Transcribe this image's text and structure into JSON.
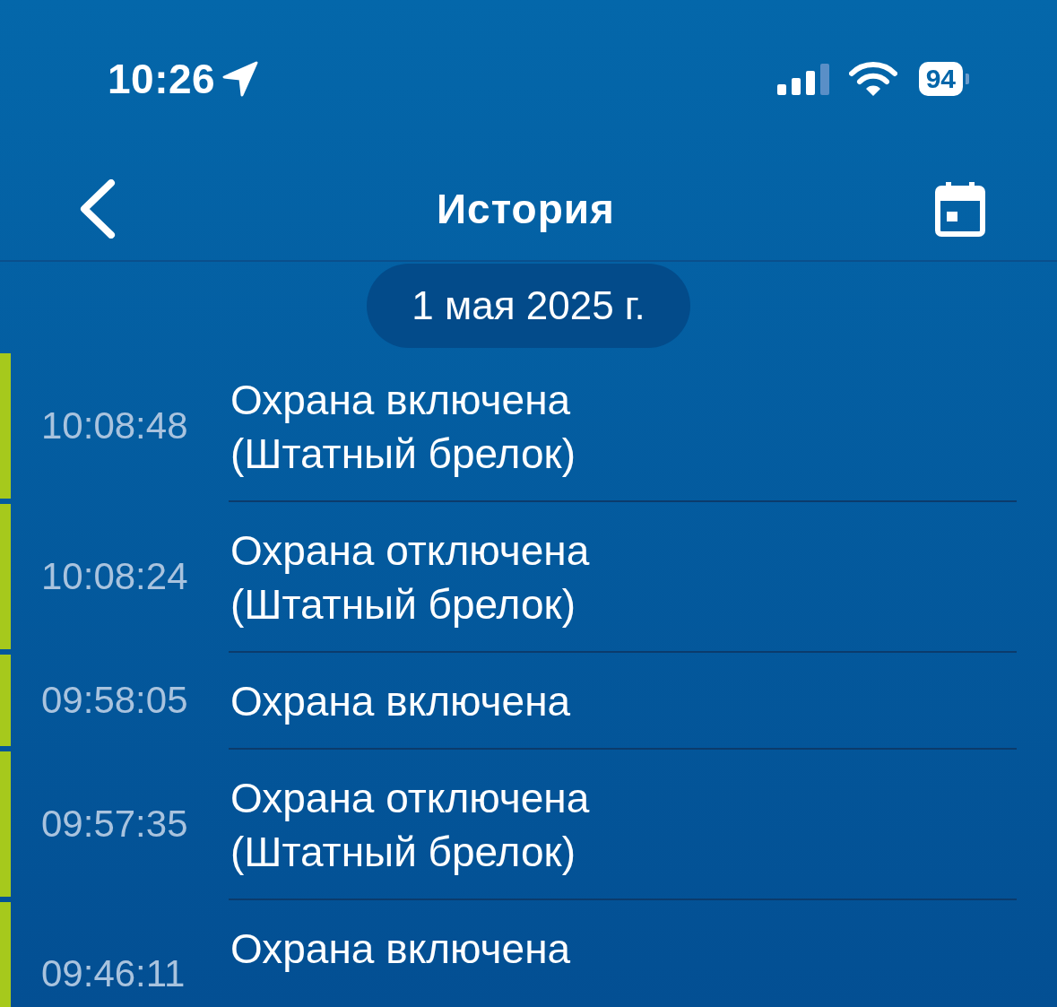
{
  "status_bar": {
    "time": "10:26",
    "battery": "94"
  },
  "nav": {
    "title": "История"
  },
  "date": "1 мая 2025 г.",
  "events": [
    {
      "time": "10:08:48",
      "lines": [
        "Охрана включена",
        "(Штатный брелок)"
      ],
      "color": "#a6c91c"
    },
    {
      "time": "10:08:24",
      "lines": [
        "Охрана отключена",
        "(Штатный брелок)"
      ],
      "color": "#a6c91c"
    },
    {
      "time": "09:58:05",
      "lines": [
        "Охрана включена"
      ],
      "color": "#a6c91c"
    },
    {
      "time": "09:57:35",
      "lines": [
        "Охрана отключена",
        "(Штатный брелок)"
      ],
      "color": "#a6c91c"
    },
    {
      "time": "09:46:11",
      "lines": [
        "Охрана включена"
      ],
      "color": "#a6c91c"
    }
  ]
}
